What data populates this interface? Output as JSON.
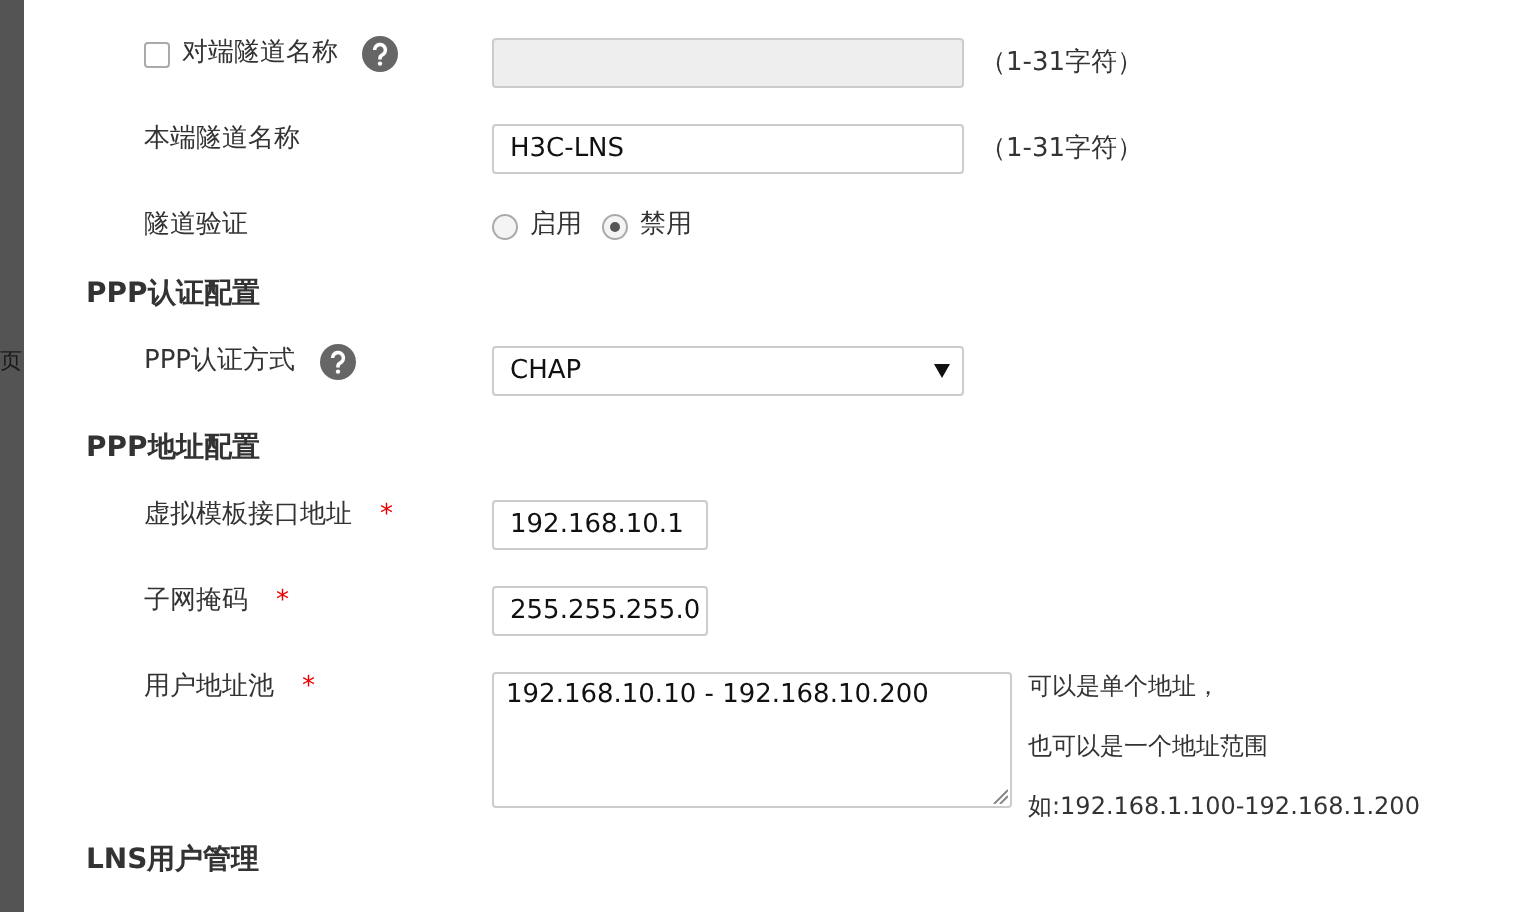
{
  "backdrop": {
    "text": "页"
  },
  "items": [
    {
      "kind": "text",
      "label": "对端隧道名称",
      "checkbox": {
        "checked": false
      },
      "help": true,
      "required": false,
      "disabled": true,
      "hint": "（1-31字符）"
    },
    {
      "kind": "text",
      "label": "本端隧道名称",
      "help": false,
      "required": false,
      "disabled": false,
      "value": "H3C-LNS",
      "hint": "（1-31字符）"
    },
    {
      "kind": "radio",
      "label": "隧道验证",
      "help": false,
      "required": false,
      "options": [
        {
          "label": "启用",
          "selected": false
        },
        {
          "label": "禁用",
          "selected": true
        }
      ]
    },
    {
      "kind": "heading",
      "label": "PPP认证配置"
    },
    {
      "kind": "select",
      "label": "PPP认证方式",
      "help": true,
      "required": false,
      "value": "CHAP"
    },
    {
      "kind": "heading",
      "label": "PPP地址配置"
    },
    {
      "kind": "short",
      "label": "虚拟模板接口地址",
      "help": false,
      "required_mark": "*",
      "disabled": false,
      "value": "192.168.10.1"
    },
    {
      "kind": "short",
      "label": "子网掩码",
      "help": false,
      "required_mark": "*",
      "disabled": false,
      "value": "255.255.255.0"
    },
    {
      "kind": "textarea",
      "label": "用户地址池",
      "help": false,
      "required_mark": "*",
      "value": "192.168.10.10 - 192.168.10.200",
      "notes": [
        "可以是单个地址，",
        "也可以是一个地址范围",
        "如:192.168.1.100-192.168.1.200"
      ]
    },
    {
      "kind": "heading",
      "label": "LNS用户管理"
    }
  ]
}
